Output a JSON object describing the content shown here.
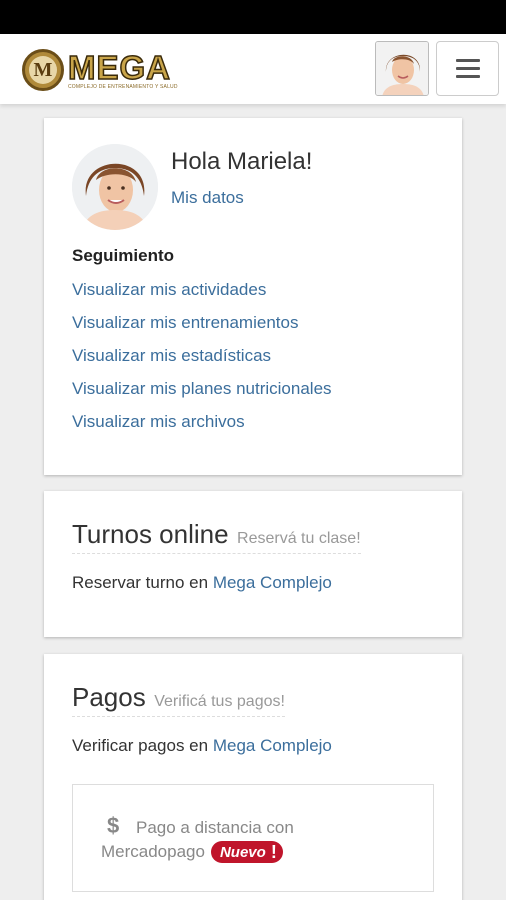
{
  "header": {
    "logo_letter": "M",
    "logo_word": "MEGA",
    "logo_subtitle": "COMPLEJO DE ENTRENAMIENTO Y SALUD",
    "menu_icon": "hamburger-menu-icon"
  },
  "profile": {
    "greeting": "Hola Mariela!",
    "my_data_link": "Mis datos"
  },
  "tracking": {
    "title": "Seguimiento",
    "links": [
      "Visualizar mis actividades",
      "Visualizar mis entrenamientos",
      "Visualizar mis estadísticas",
      "Visualizar mis planes nutricionales",
      "Visualizar mis archivos"
    ]
  },
  "turnos": {
    "title": "Turnos online",
    "subtitle": "Reservá tu clase!",
    "text": "Reservar turno en",
    "link": "Mega Complejo"
  },
  "pagos": {
    "title": "Pagos",
    "subtitle": "Verificá tus pagos!",
    "text": "Verificar pagos en",
    "link": "Mega Complejo",
    "remote_line1": "Pago a distancia con",
    "remote_line2": "Mercadopago",
    "badge": "Nuevo",
    "badge_mark": "!",
    "currency_symbol": "$"
  },
  "colors": {
    "link": "#3b6e9c",
    "badge": "#c0152b",
    "logo_gold": "#c9a54a",
    "background": "#eeeeee"
  }
}
